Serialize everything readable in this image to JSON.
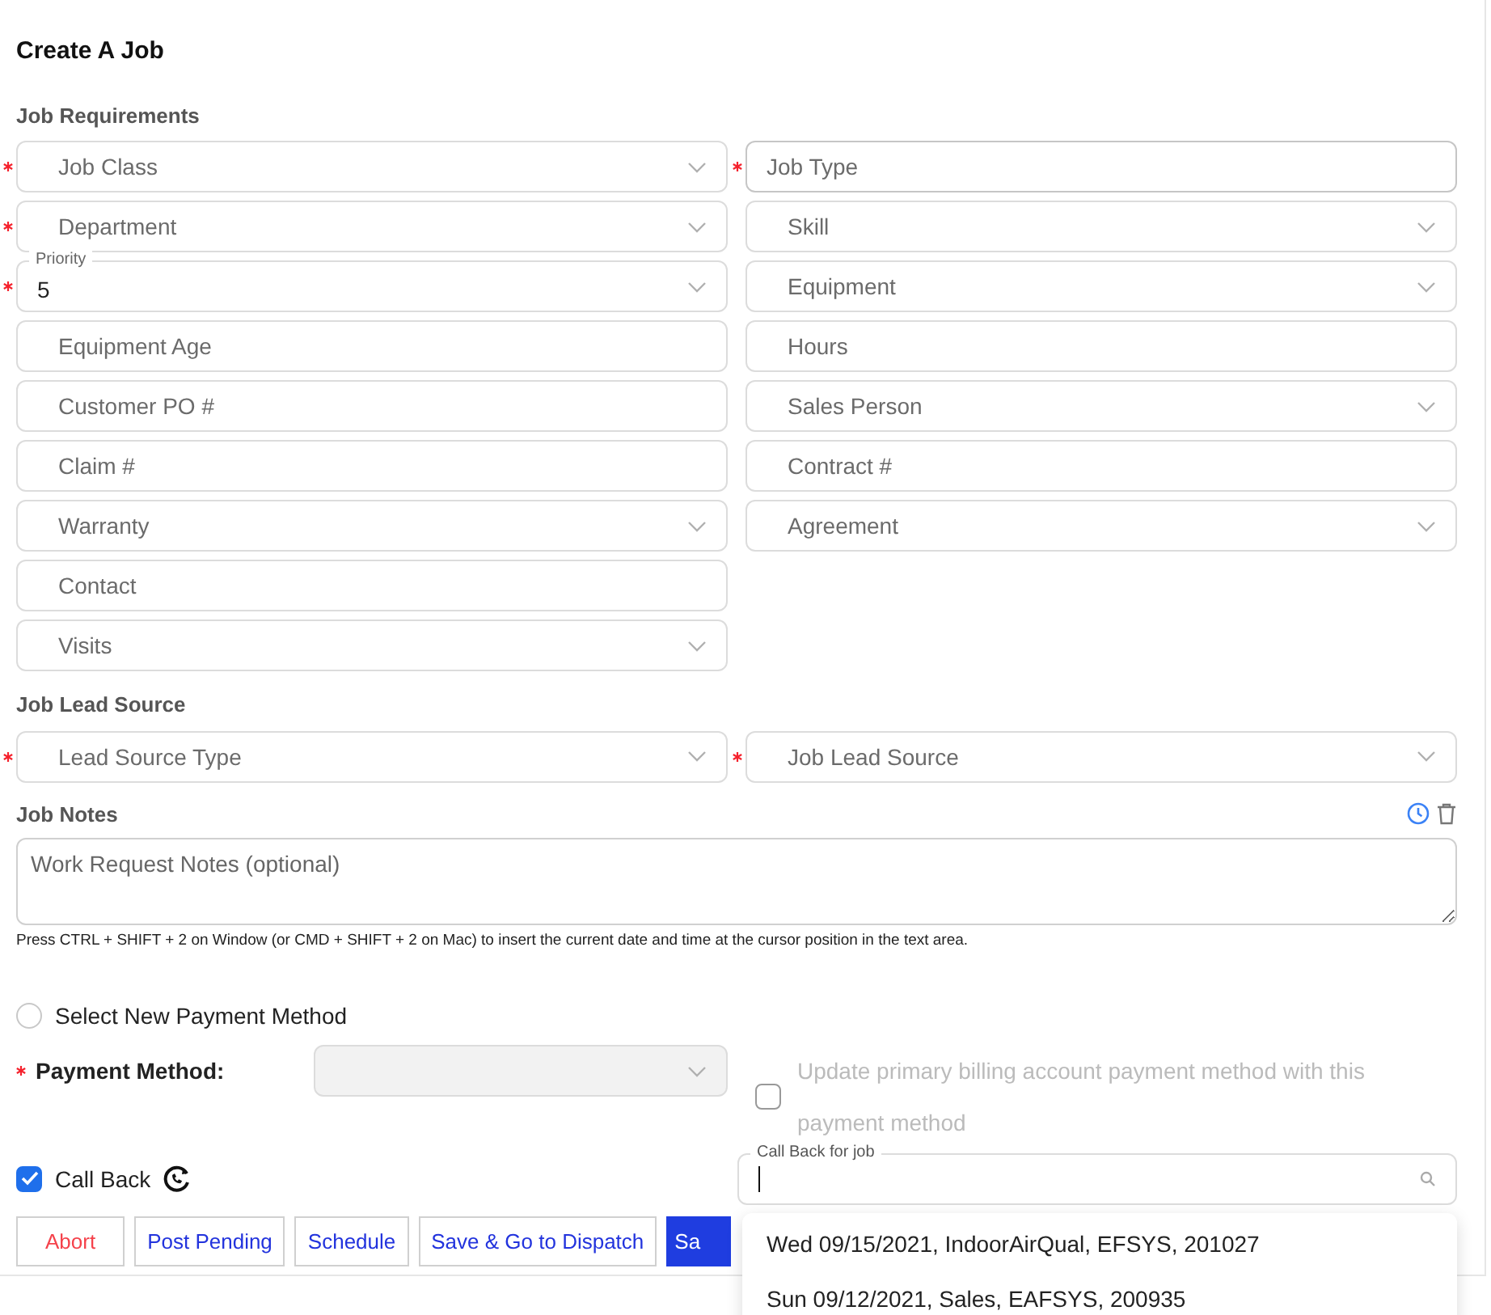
{
  "title": "Create A Job",
  "sections": [
    {
      "heading": "Job Requirements",
      "rows": [
        [
          {
            "kind": "select",
            "placeholder": "Job Class",
            "required": true
          },
          {
            "kind": "plain",
            "placeholder": "Job Type",
            "required": true
          }
        ],
        [
          {
            "kind": "select",
            "placeholder": "Department",
            "required": true
          },
          {
            "kind": "select",
            "placeholder": "Skill",
            "required": false
          }
        ],
        [
          {
            "kind": "select",
            "label": "Priority",
            "value": "5",
            "required": true
          },
          {
            "kind": "select",
            "placeholder": "Equipment",
            "required": false
          }
        ],
        [
          {
            "kind": "text",
            "placeholder": "Equipment Age",
            "required": false
          },
          {
            "kind": "text",
            "placeholder": "Hours",
            "required": false
          }
        ],
        [
          {
            "kind": "text",
            "placeholder": "Customer PO #",
            "required": false
          },
          {
            "kind": "select",
            "placeholder": "Sales Person",
            "required": false
          }
        ],
        [
          {
            "kind": "text",
            "placeholder": "Claim #",
            "required": false
          },
          {
            "kind": "text",
            "placeholder": "Contract #",
            "required": false
          }
        ],
        [
          {
            "kind": "select",
            "placeholder": "Warranty",
            "required": false
          },
          {
            "kind": "select",
            "placeholder": "Agreement",
            "required": false
          }
        ],
        [
          {
            "kind": "text",
            "placeholder": "Contact",
            "required": false
          }
        ],
        [
          {
            "kind": "select",
            "placeholder": "Visits",
            "required": false
          }
        ]
      ]
    },
    {
      "heading": "Job Lead Source",
      "rows": [
        [
          {
            "kind": "select",
            "placeholder": "Lead Source Type",
            "required": true
          },
          {
            "kind": "select",
            "placeholder": "Job Lead Source",
            "required": true
          }
        ]
      ]
    }
  ],
  "notes": {
    "heading": "Job Notes",
    "placeholder": "Work Request Notes (optional)",
    "hint": "Press CTRL + SHIFT + 2 on Window (or CMD + SHIFT + 2 on Mac) to insert the current date and time at the cursor position in the text area."
  },
  "payment": {
    "radio": {
      "label": "Select New Payment Method",
      "selected": false
    },
    "label": "Payment Method:",
    "required": true,
    "select_disabled": true,
    "update": {
      "label": "Update primary billing account payment method with this payment method",
      "checked": false,
      "disabled": true
    }
  },
  "callback": {
    "label": "Call Back",
    "checked": true,
    "field_label": "Call Back for job",
    "options": [
      {
        "label": "Wed 09/15/2021, IndoorAirQual, EFSYS, 201027",
        "selected": false
      },
      {
        "label": "Sun 09/12/2021, Sales, EAFSYS, 200935",
        "selected": false
      }
    ]
  },
  "buttons": [
    {
      "label": "Abort",
      "kind": "danger"
    },
    {
      "label": "Post Pending",
      "kind": "outline"
    },
    {
      "label": "Schedule",
      "kind": "outline"
    },
    {
      "label": "Save & Go to Dispatch",
      "kind": "outline"
    },
    {
      "label": "Sa",
      "kind": "primary"
    }
  ]
}
